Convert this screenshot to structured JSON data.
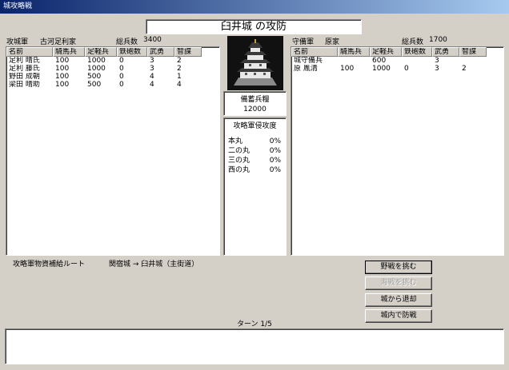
{
  "window": {
    "title": "城攻略戦"
  },
  "castle_title": "臼井城 の攻防",
  "attacker": {
    "label": "攻城軍",
    "leader": "古河足利家",
    "total_label": "総兵数",
    "total": "3400",
    "columns": [
      "名前",
      "騎馬兵",
      "足軽兵",
      "鉄砲数",
      "武勇",
      "智謀"
    ],
    "rows": [
      [
        "足利 晴氏",
        "100",
        "1000",
        "0",
        "3",
        "2"
      ],
      [
        "足利 藤氏",
        "100",
        "1000",
        "0",
        "3",
        "2"
      ],
      [
        "野田 成朝",
        "100",
        "500",
        "0",
        "4",
        "1"
      ],
      [
        "梁田 晴助",
        "100",
        "500",
        "0",
        "4",
        "4"
      ]
    ]
  },
  "defender": {
    "label": "守備軍",
    "leader": "原家",
    "total_label": "総兵数",
    "total": "1700",
    "columns": [
      "名前",
      "騎馬兵",
      "足軽兵",
      "鉄砲数",
      "武勇",
      "智謀"
    ],
    "rows": [
      [
        "城守備兵",
        "",
        "600",
        "",
        "3",
        ""
      ],
      [
        "原 胤清",
        "100",
        "1000",
        "0",
        "3",
        "2"
      ]
    ]
  },
  "supply": {
    "label": "備蓄兵糧",
    "value": "12000"
  },
  "invasion": {
    "title": "攻略軍侵攻度",
    "items": [
      {
        "name": "本丸",
        "value": "0%"
      },
      {
        "name": "二の丸",
        "value": "0%"
      },
      {
        "name": "三の丸",
        "value": "0%"
      },
      {
        "name": "西の丸",
        "value": "0%"
      }
    ]
  },
  "route": {
    "label": "攻略軍物資補給ルート",
    "value": "関宿城 → 臼井城（主街道）"
  },
  "buttons": {
    "field_battle": "野戦を挑む",
    "naval_battle": "海戦を挑む",
    "retreat": "城から退却",
    "defend": "城内で防戦"
  },
  "turn": "ターン 1/5",
  "message": ""
}
